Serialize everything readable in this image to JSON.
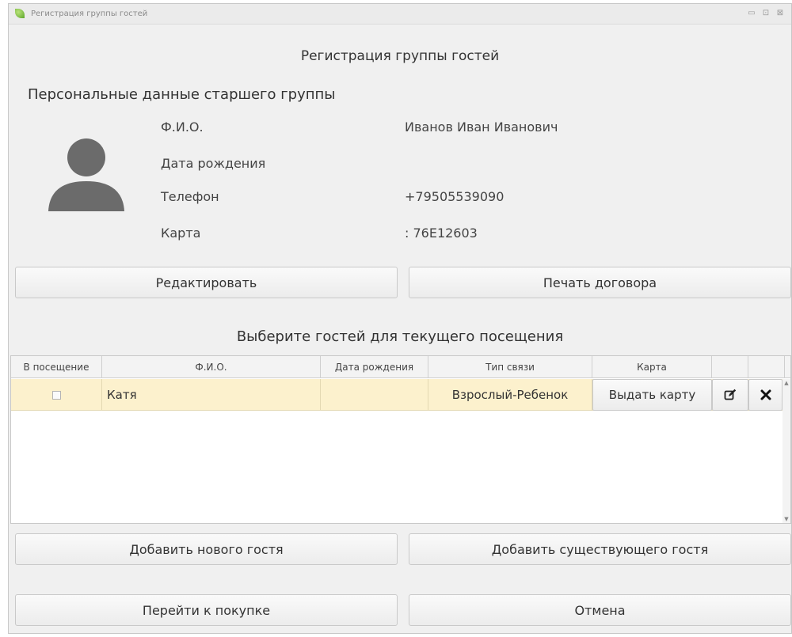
{
  "window": {
    "title": "Регистрация группы гостей",
    "controls": {
      "minimize": "▭",
      "maximize": "⊡",
      "close": "⊠"
    }
  },
  "page_title": "Регистрация группы гостей",
  "leader": {
    "section_title": "Персональные данные старшего группы",
    "avatar_icon": "person-icon",
    "fields": [
      {
        "label": "Ф.И.О.",
        "value": "Иванов Иван Иванович"
      },
      {
        "label": "Дата рождения",
        "value": ""
      },
      {
        "label": "Телефон",
        "value": "+79505539090"
      },
      {
        "label": "Карта",
        "value": ": 76E12603"
      }
    ]
  },
  "actions_top": {
    "edit_label": "Редактировать",
    "print_label": "Печать договора"
  },
  "guests": {
    "title": "Выберите гостей для текущего посещения",
    "columns": [
      "В посещение",
      "Ф.И.О.",
      "Дата рождения",
      "Тип связи",
      "Карта",
      "",
      ""
    ],
    "rows": [
      {
        "selected": false,
        "name": "Катя",
        "birth_date": "",
        "relation": "Взрослый-Ребенок",
        "card_button": "Выдать карту",
        "edit_icon": "edit-icon",
        "delete_icon": "delete-icon"
      }
    ],
    "row_highlight_color": "#fcf1cd"
  },
  "actions_bottom": {
    "add_new_label": "Добавить нового гостя",
    "add_existing_label": "Добавить существующего гостя",
    "purchase_label": "Перейти к покупке",
    "cancel_label": "Отмена"
  }
}
